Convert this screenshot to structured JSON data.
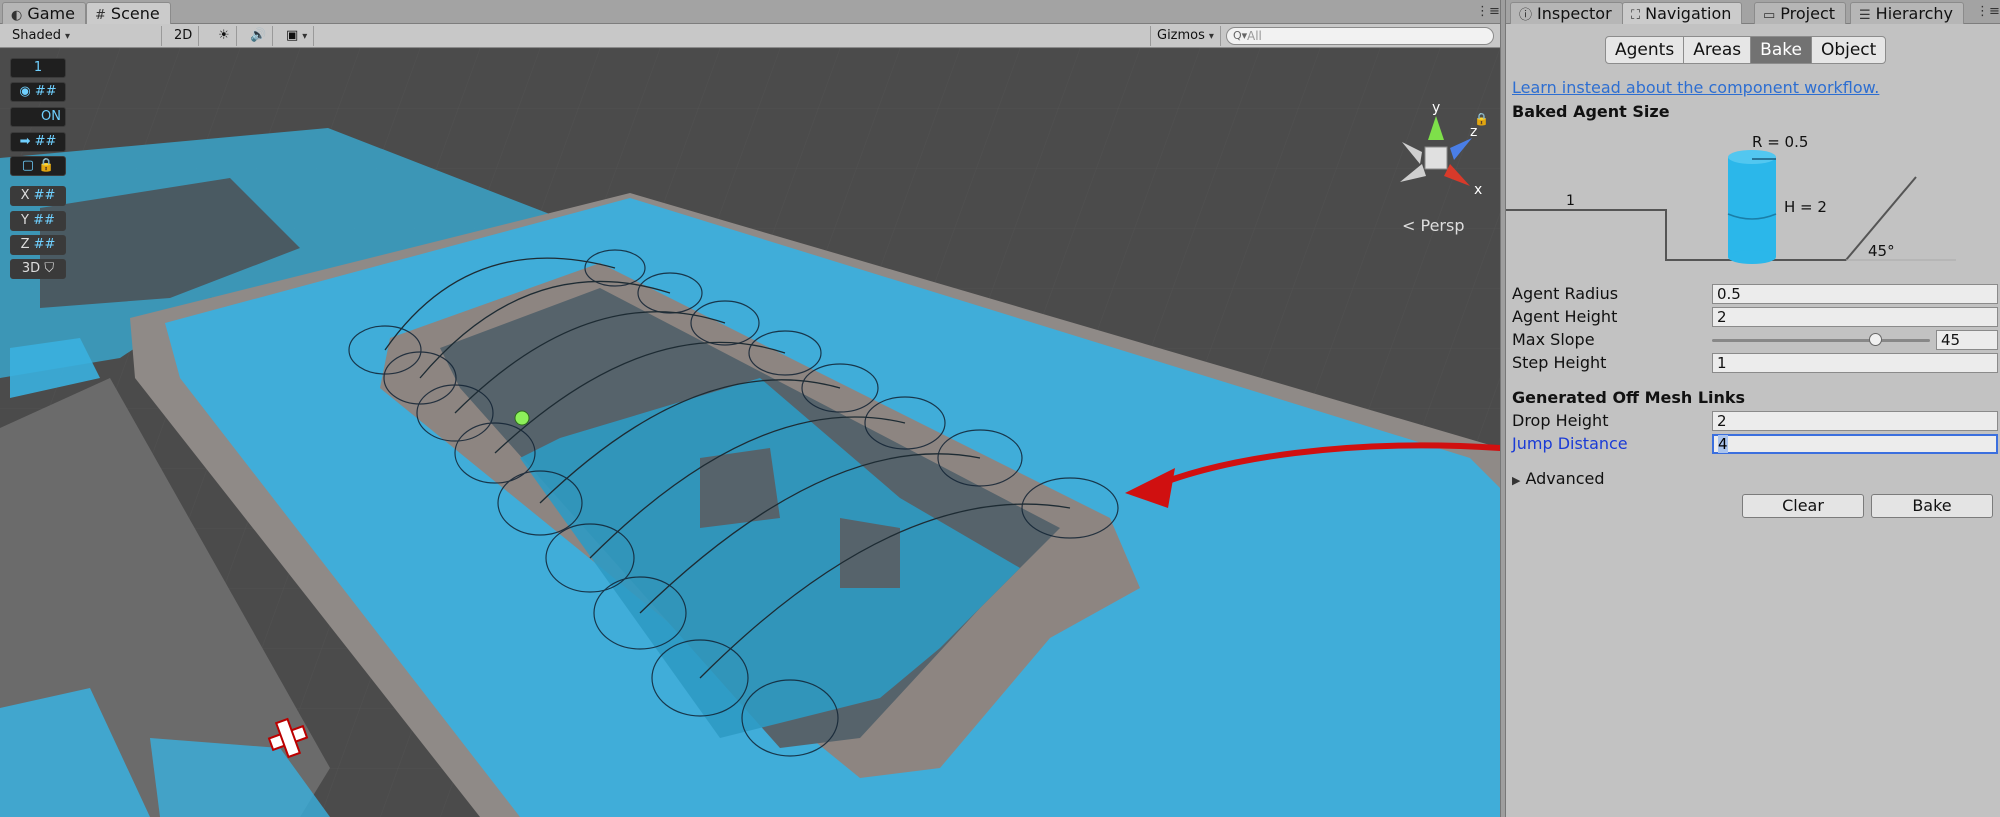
{
  "scene_tabs": [
    {
      "label": "Game",
      "icon": "game-icon"
    },
    {
      "label": "Scene",
      "icon": "scene-icon"
    }
  ],
  "toolbar": {
    "shading": "Shaded",
    "mode_2d": "2D",
    "gizmos": "Gizmos",
    "search_placeholder": "All"
  },
  "overlay": {
    "counter": "1",
    "on_label": "ON",
    "x": "X",
    "y": "Y",
    "z": "Z",
    "threed": "3D",
    "persp": "Persp",
    "axis_y": "y",
    "axis_z": "z",
    "axis_x": "x"
  },
  "panel_tabs": [
    {
      "label": "Inspector",
      "icon": "info-icon"
    },
    {
      "label": "Navigation",
      "icon": "navigation-icon"
    },
    {
      "label": "Project",
      "icon": "folder-icon"
    },
    {
      "label": "Hierarchy",
      "icon": "list-icon"
    }
  ],
  "nav_tabs": {
    "agents": "Agents",
    "areas": "Areas",
    "bake": "Bake",
    "object": "Object"
  },
  "link_text": "Learn instead about the component workflow.",
  "baked_header": "Baked Agent Size",
  "diagram": {
    "radius_label": "R = 0.5",
    "height_label": "H = 2",
    "step_label": "1",
    "slope_label": "45°"
  },
  "fields": {
    "agent_radius": {
      "label": "Agent Radius",
      "value": "0.5"
    },
    "agent_height": {
      "label": "Agent Height",
      "value": "2"
    },
    "max_slope": {
      "label": "Max Slope",
      "value": "45",
      "fraction": 0.75
    },
    "step_height": {
      "label": "Step Height",
      "value": "1"
    }
  },
  "offmesh_header": "Generated Off Mesh Links",
  "offmesh": {
    "drop_height": {
      "label": "Drop Height",
      "value": "2"
    },
    "jump_distance": {
      "label": "Jump Distance",
      "value": "4"
    }
  },
  "advanced_label": "Advanced",
  "buttons": {
    "clear": "Clear",
    "bake": "Bake"
  },
  "colors": {
    "navmesh": "#3ab0df",
    "accent_link": "#2d6ed1",
    "annotation_arrow": "#d01010"
  }
}
